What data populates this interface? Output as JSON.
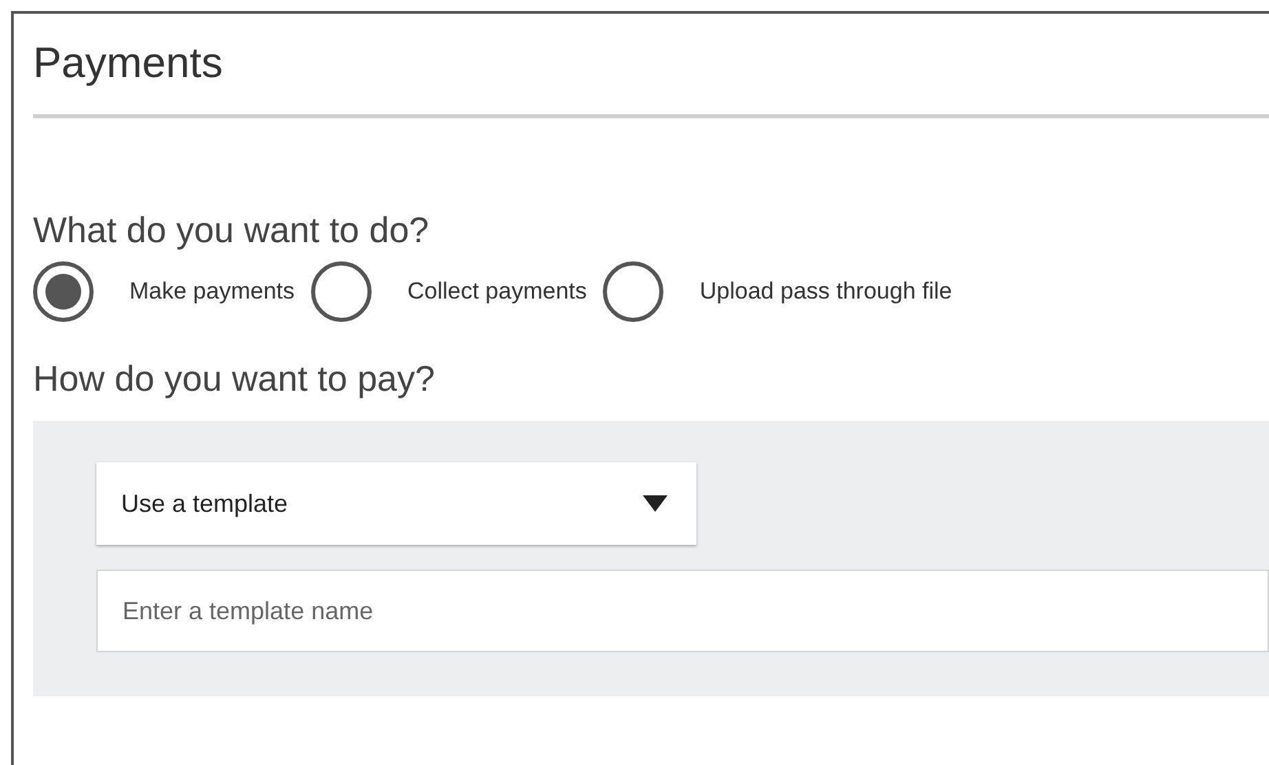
{
  "title": "Payments",
  "action_question": "What do you want to do?",
  "actions": [
    {
      "label": "Make payments",
      "selected": true
    },
    {
      "label": "Collect payments",
      "selected": false
    },
    {
      "label": "Upload pass through file",
      "selected": false
    }
  ],
  "pay_question": "How do you want to pay?",
  "method_dropdown": {
    "value": "Use a template"
  },
  "template_field": {
    "placeholder": "Enter a template name"
  }
}
